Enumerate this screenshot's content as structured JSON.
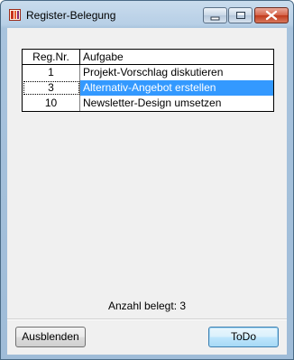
{
  "window": {
    "title": "Register-Belegung",
    "icon": "app-register-icon",
    "controls": [
      "minimize-icon",
      "maximize-icon",
      "close-icon"
    ]
  },
  "table": {
    "headers": [
      "Reg.Nr.",
      "Aufgabe"
    ],
    "rows": [
      {
        "nr": "1",
        "task": "Projekt-Vorschlag diskutieren",
        "selected": false
      },
      {
        "nr": "3",
        "task": "Alternativ-Angebot erstellen",
        "selected": true
      },
      {
        "nr": "10",
        "task": "Newsletter-Design umsetzen",
        "selected": false
      }
    ]
  },
  "status": {
    "count_text": "Anzahl belegt: 3"
  },
  "buttons": {
    "hide": "Ausblenden",
    "todo": "ToDo"
  },
  "colors": {
    "selection": "#3399ff",
    "client_bg": "#f0f0f0"
  }
}
